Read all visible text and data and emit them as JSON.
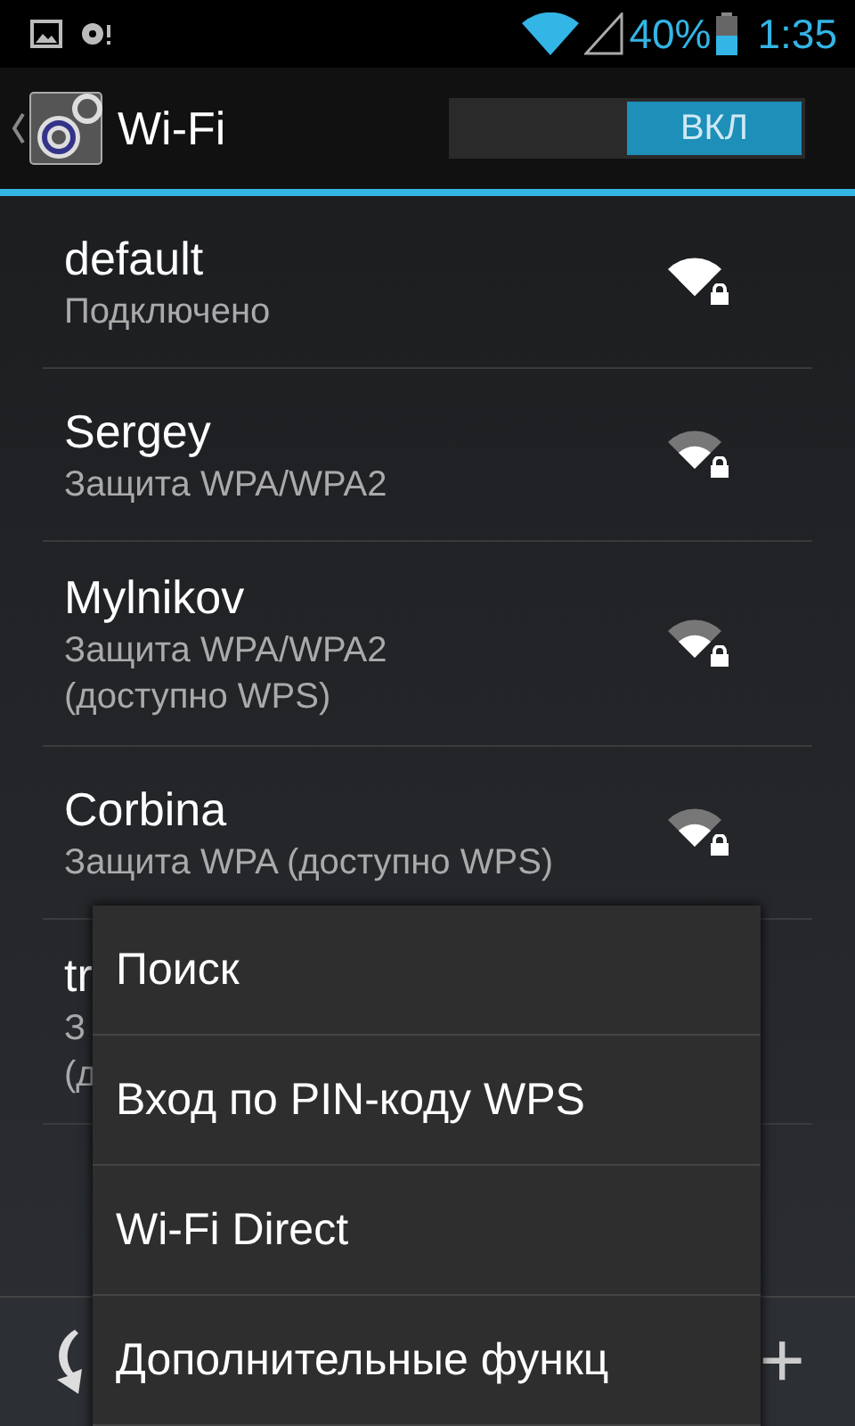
{
  "status_bar": {
    "battery_percent": "40%",
    "time": "1:35"
  },
  "action_bar": {
    "title": "Wi-Fi",
    "switch": {
      "label": "ВКЛ",
      "on": true
    }
  },
  "networks": [
    {
      "name": "default",
      "status": [
        "Подключено"
      ],
      "connected": true,
      "secured": true
    },
    {
      "name": "Sergey",
      "status": [
        "Защита WPA/WPA2"
      ],
      "connected": false,
      "secured": true
    },
    {
      "name": "Mylnikov",
      "status": [
        "Защита WPA/WPA2",
        "(доступно WPS)"
      ],
      "connected": false,
      "secured": true
    },
    {
      "name": "Corbina",
      "status": [
        "Защита WPA (доступно WPS)"
      ],
      "connected": false,
      "secured": true
    },
    {
      "name": "tr",
      "status": [
        "З",
        "(д"
      ]
    }
  ],
  "bottom_bar": {
    "add_label": "+"
  },
  "menu": {
    "items": [
      "Поиск",
      "Вход по PIN-коду WPS",
      "Wi-Fi Direct",
      "Дополнительные функц"
    ]
  }
}
